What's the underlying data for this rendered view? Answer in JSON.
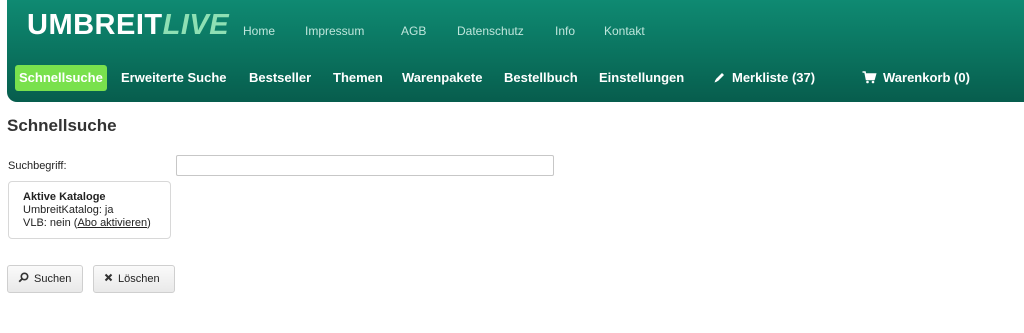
{
  "logo": {
    "part1": "UMBREIT",
    "part2": "LIVE"
  },
  "topnav": [
    "Home",
    "Impressum",
    "AGB",
    "Datenschutz",
    "Info",
    "Kontakt"
  ],
  "mainnav": {
    "items": [
      "Schnellsuche",
      "Erweiterte Suche",
      "Bestseller",
      "Themen",
      "Warenpakete",
      "Bestellbuch",
      "Einstellungen"
    ],
    "active": "Schnellsuche",
    "merkliste": "Merkliste (37)",
    "warenkorb": "Warenkorb (0)"
  },
  "page": {
    "title": "Schnellsuche"
  },
  "search": {
    "label": "Suchbegriff:",
    "value": "",
    "placeholder": ""
  },
  "catalogs": {
    "heading": "Aktive Kataloge",
    "umbreit": "UmbreitKatalog: ja",
    "vlb_prefix": "VLB: nein ",
    "vlb_open": "(",
    "vlb_link": "Abo aktivieren",
    "vlb_close": ")"
  },
  "buttons": {
    "search": "Suchen",
    "clear": "Löschen"
  },
  "icons": {
    "search": "magnifier-icon",
    "clear": "x-icon",
    "merkliste": "pencil-icon",
    "warenkorb": "cart-icon"
  },
  "colors": {
    "header": "#0a725e",
    "active_nav": "#79e14d",
    "logo_accent": "#8ee0b4",
    "topnav_text": "#bfe6dc"
  }
}
